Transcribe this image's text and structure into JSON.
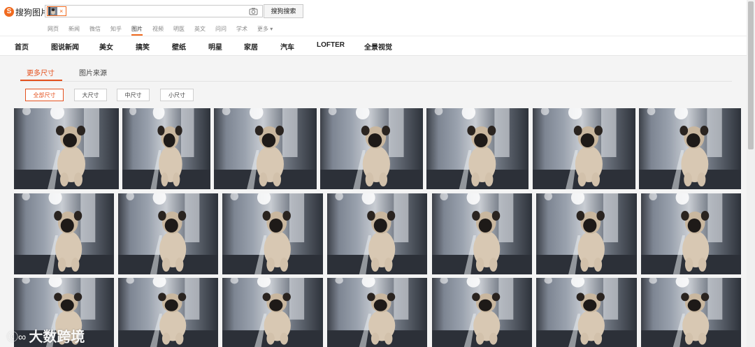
{
  "logo": {
    "badge": "S",
    "text": "搜狗图片"
  },
  "search": {
    "chip_close": "×",
    "button_label": "搜狗搜索"
  },
  "nav_links": [
    {
      "label": "网页",
      "active": false
    },
    {
      "label": "新闻",
      "active": false
    },
    {
      "label": "微信",
      "active": false
    },
    {
      "label": "知乎",
      "active": false
    },
    {
      "label": "图片",
      "active": true
    },
    {
      "label": "视频",
      "active": false
    },
    {
      "label": "明医",
      "active": false
    },
    {
      "label": "英文",
      "active": false
    },
    {
      "label": "问问",
      "active": false
    },
    {
      "label": "学术",
      "active": false
    },
    {
      "label": "更多 ▾",
      "active": false
    }
  ],
  "categories": [
    "首页",
    "图说新闻",
    "美女",
    "搞笑",
    "壁纸",
    "明星",
    "家居",
    "汽车",
    "LOFTER",
    "全景视觉"
  ],
  "tabs": [
    {
      "label": "更多尺寸",
      "active": true
    },
    {
      "label": "图片来源",
      "active": false
    }
  ],
  "sizes": [
    {
      "label": "全部尺寸",
      "active": true
    },
    {
      "label": "大尺寸",
      "active": false
    },
    {
      "label": "中尺寸",
      "active": false
    },
    {
      "label": "小尺寸",
      "active": false
    }
  ],
  "watermark": {
    "logo": "ⓒ∞",
    "text": "大数跨境"
  },
  "colors": {
    "accent": "#e4511e",
    "logo": "#f06a1f"
  }
}
